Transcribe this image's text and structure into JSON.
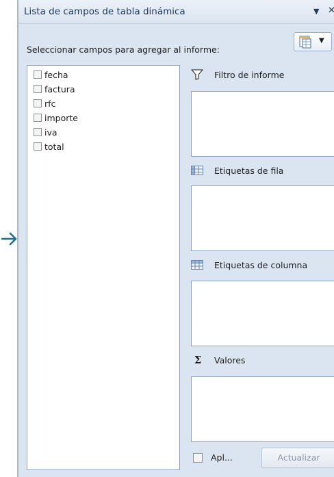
{
  "panel": {
    "title": "Lista de campos de tabla dinámica",
    "dropdown_glyph": "▼",
    "close_glyph": "✕",
    "select_label": "Seleccionar campos para agregar al informe:",
    "layout_button_icon": "field-list-layout-icon"
  },
  "fields": [
    {
      "label": "fecha",
      "checked": false
    },
    {
      "label": "factura",
      "checked": false
    },
    {
      "label": "rfc",
      "checked": false
    },
    {
      "label": "importe",
      "checked": false
    },
    {
      "label": "iva",
      "checked": false
    },
    {
      "label": "total",
      "checked": false
    }
  ],
  "areas": {
    "filter": {
      "label": "Filtro de informe",
      "icon": "filter-icon"
    },
    "rows": {
      "label": "Etiquetas de fila",
      "icon": "row-labels-icon"
    },
    "columns": {
      "label": "Etiquetas de columna",
      "icon": "column-labels-icon"
    },
    "values": {
      "label": "Valores",
      "icon": "sigma-icon"
    }
  },
  "footer": {
    "defer_label": "Apl...",
    "update_label": "Actualizar"
  },
  "colors": {
    "panel_bg": "#dbe5f1",
    "arrow": "#1f6e8c"
  }
}
